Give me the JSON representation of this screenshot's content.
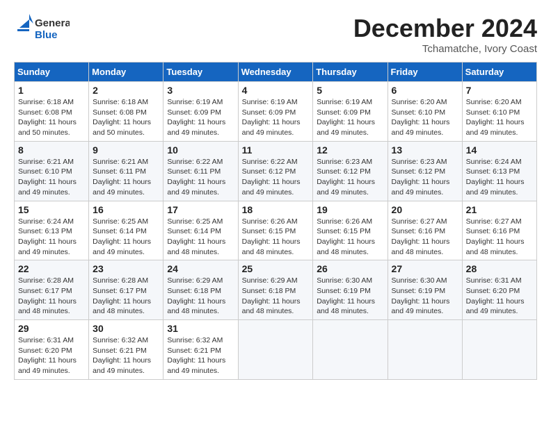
{
  "header": {
    "logo_line1": "General",
    "logo_line2": "Blue",
    "month": "December 2024",
    "location": "Tchamatche, Ivory Coast"
  },
  "weekdays": [
    "Sunday",
    "Monday",
    "Tuesday",
    "Wednesday",
    "Thursday",
    "Friday",
    "Saturday"
  ],
  "weeks": [
    [
      {
        "day": "1",
        "info": "Sunrise: 6:18 AM\nSunset: 6:08 PM\nDaylight: 11 hours\nand 50 minutes."
      },
      {
        "day": "2",
        "info": "Sunrise: 6:18 AM\nSunset: 6:08 PM\nDaylight: 11 hours\nand 50 minutes."
      },
      {
        "day": "3",
        "info": "Sunrise: 6:19 AM\nSunset: 6:09 PM\nDaylight: 11 hours\nand 49 minutes."
      },
      {
        "day": "4",
        "info": "Sunrise: 6:19 AM\nSunset: 6:09 PM\nDaylight: 11 hours\nand 49 minutes."
      },
      {
        "day": "5",
        "info": "Sunrise: 6:19 AM\nSunset: 6:09 PM\nDaylight: 11 hours\nand 49 minutes."
      },
      {
        "day": "6",
        "info": "Sunrise: 6:20 AM\nSunset: 6:10 PM\nDaylight: 11 hours\nand 49 minutes."
      },
      {
        "day": "7",
        "info": "Sunrise: 6:20 AM\nSunset: 6:10 PM\nDaylight: 11 hours\nand 49 minutes."
      }
    ],
    [
      {
        "day": "8",
        "info": "Sunrise: 6:21 AM\nSunset: 6:10 PM\nDaylight: 11 hours\nand 49 minutes."
      },
      {
        "day": "9",
        "info": "Sunrise: 6:21 AM\nSunset: 6:11 PM\nDaylight: 11 hours\nand 49 minutes."
      },
      {
        "day": "10",
        "info": "Sunrise: 6:22 AM\nSunset: 6:11 PM\nDaylight: 11 hours\nand 49 minutes."
      },
      {
        "day": "11",
        "info": "Sunrise: 6:22 AM\nSunset: 6:12 PM\nDaylight: 11 hours\nand 49 minutes."
      },
      {
        "day": "12",
        "info": "Sunrise: 6:23 AM\nSunset: 6:12 PM\nDaylight: 11 hours\nand 49 minutes."
      },
      {
        "day": "13",
        "info": "Sunrise: 6:23 AM\nSunset: 6:12 PM\nDaylight: 11 hours\nand 49 minutes."
      },
      {
        "day": "14",
        "info": "Sunrise: 6:24 AM\nSunset: 6:13 PM\nDaylight: 11 hours\nand 49 minutes."
      }
    ],
    [
      {
        "day": "15",
        "info": "Sunrise: 6:24 AM\nSunset: 6:13 PM\nDaylight: 11 hours\nand 49 minutes."
      },
      {
        "day": "16",
        "info": "Sunrise: 6:25 AM\nSunset: 6:14 PM\nDaylight: 11 hours\nand 49 minutes."
      },
      {
        "day": "17",
        "info": "Sunrise: 6:25 AM\nSunset: 6:14 PM\nDaylight: 11 hours\nand 48 minutes."
      },
      {
        "day": "18",
        "info": "Sunrise: 6:26 AM\nSunset: 6:15 PM\nDaylight: 11 hours\nand 48 minutes."
      },
      {
        "day": "19",
        "info": "Sunrise: 6:26 AM\nSunset: 6:15 PM\nDaylight: 11 hours\nand 48 minutes."
      },
      {
        "day": "20",
        "info": "Sunrise: 6:27 AM\nSunset: 6:16 PM\nDaylight: 11 hours\nand 48 minutes."
      },
      {
        "day": "21",
        "info": "Sunrise: 6:27 AM\nSunset: 6:16 PM\nDaylight: 11 hours\nand 48 minutes."
      }
    ],
    [
      {
        "day": "22",
        "info": "Sunrise: 6:28 AM\nSunset: 6:17 PM\nDaylight: 11 hours\nand 48 minutes."
      },
      {
        "day": "23",
        "info": "Sunrise: 6:28 AM\nSunset: 6:17 PM\nDaylight: 11 hours\nand 48 minutes."
      },
      {
        "day": "24",
        "info": "Sunrise: 6:29 AM\nSunset: 6:18 PM\nDaylight: 11 hours\nand 48 minutes."
      },
      {
        "day": "25",
        "info": "Sunrise: 6:29 AM\nSunset: 6:18 PM\nDaylight: 11 hours\nand 48 minutes."
      },
      {
        "day": "26",
        "info": "Sunrise: 6:30 AM\nSunset: 6:19 PM\nDaylight: 11 hours\nand 48 minutes."
      },
      {
        "day": "27",
        "info": "Sunrise: 6:30 AM\nSunset: 6:19 PM\nDaylight: 11 hours\nand 49 minutes."
      },
      {
        "day": "28",
        "info": "Sunrise: 6:31 AM\nSunset: 6:20 PM\nDaylight: 11 hours\nand 49 minutes."
      }
    ],
    [
      {
        "day": "29",
        "info": "Sunrise: 6:31 AM\nSunset: 6:20 PM\nDaylight: 11 hours\nand 49 minutes."
      },
      {
        "day": "30",
        "info": "Sunrise: 6:32 AM\nSunset: 6:21 PM\nDaylight: 11 hours\nand 49 minutes."
      },
      {
        "day": "31",
        "info": "Sunrise: 6:32 AM\nSunset: 6:21 PM\nDaylight: 11 hours\nand 49 minutes."
      },
      null,
      null,
      null,
      null
    ]
  ]
}
